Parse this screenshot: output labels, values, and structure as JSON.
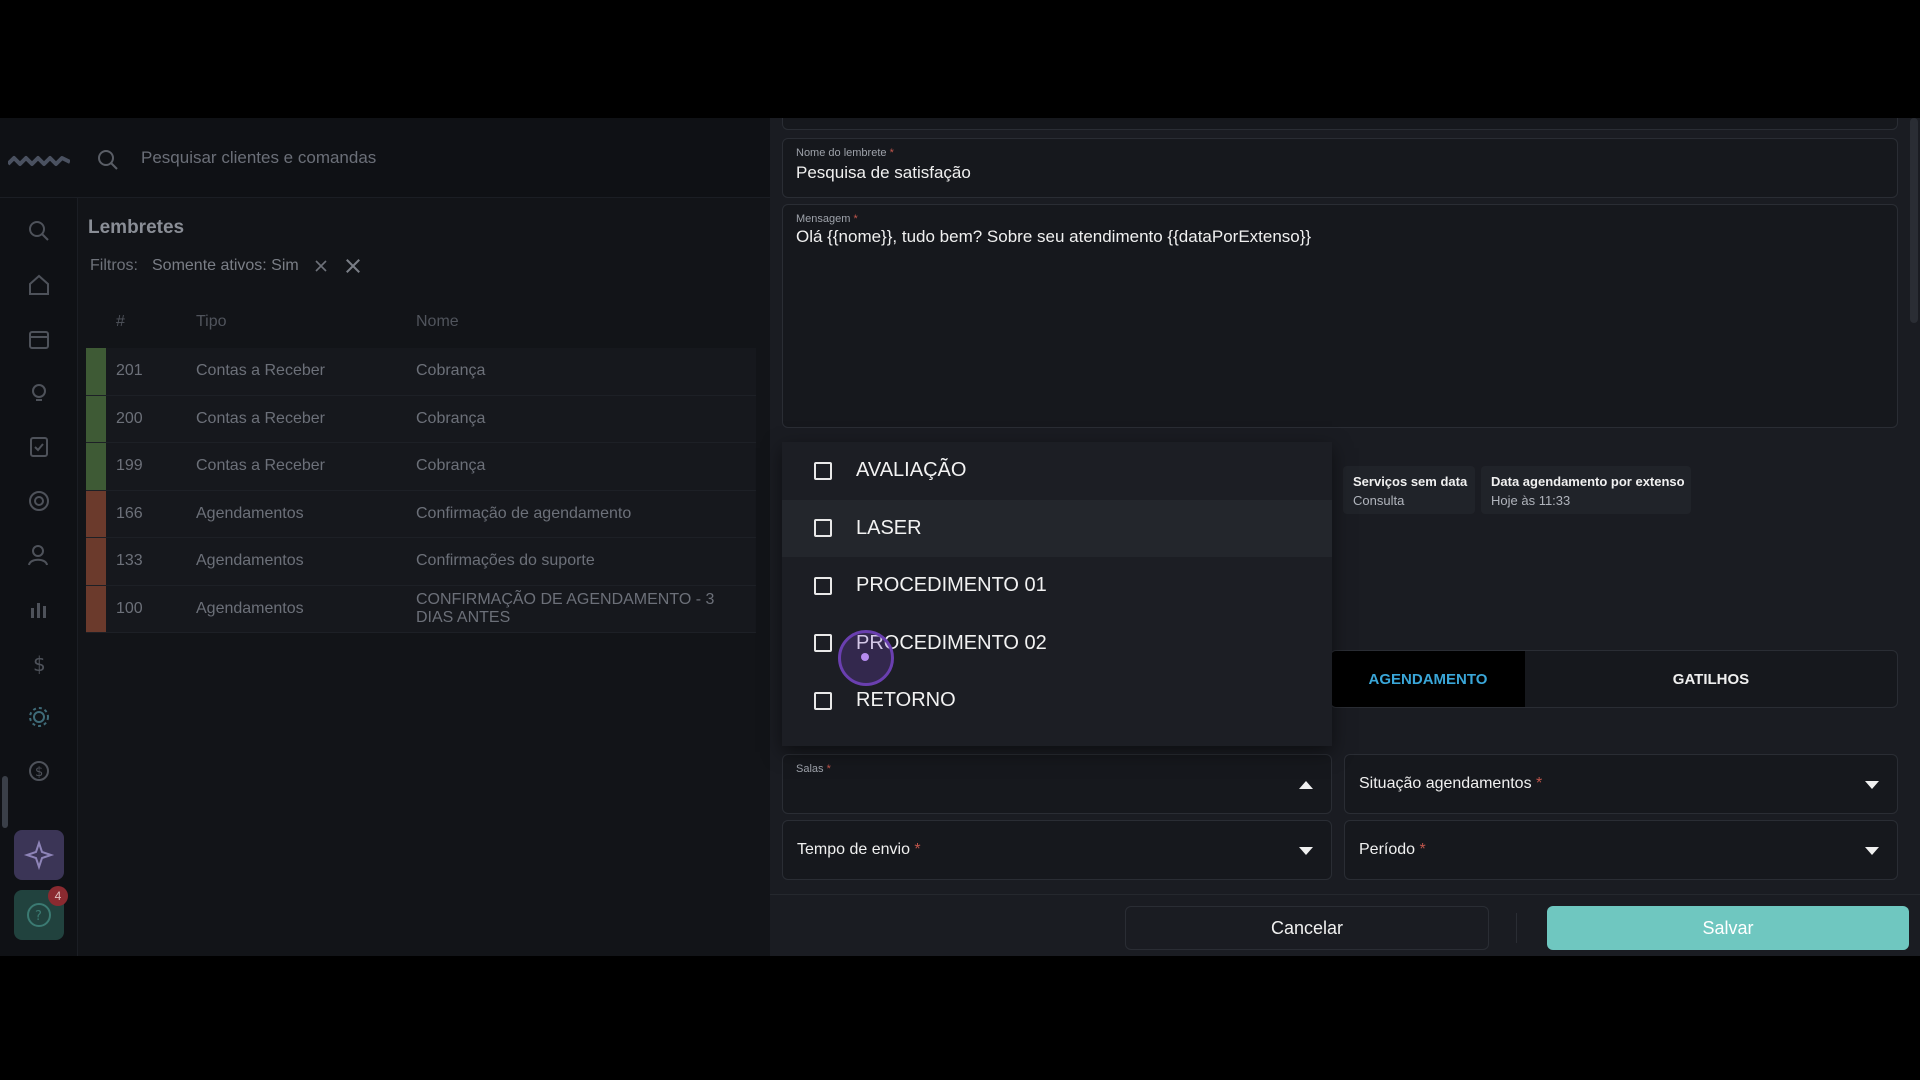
{
  "search": {
    "placeholder": "Pesquisar clientes e comandas"
  },
  "list": {
    "title": "Lembretes",
    "filters_label": "Filtros:",
    "filter_chip": "Somente ativos: Sim",
    "columns": [
      "#",
      "Tipo",
      "Nome"
    ],
    "rows": [
      {
        "id": "201",
        "tipo": "Contas a Receber",
        "nome": "Cobrança",
        "color": "#3e5a35"
      },
      {
        "id": "200",
        "tipo": "Contas a Receber",
        "nome": "Cobrança",
        "color": "#3e5a35"
      },
      {
        "id": "199",
        "tipo": "Contas a Receber",
        "nome": "Cobrança",
        "color": "#3e5a35"
      },
      {
        "id": "166",
        "tipo": "Agendamentos",
        "nome": "Confirmação de agendamento",
        "color": "#6b3a2c"
      },
      {
        "id": "133",
        "tipo": "Agendamentos",
        "nome": "Confirmações do suporte",
        "color": "#6b3a2c"
      },
      {
        "id": "100",
        "tipo": "Agendamentos",
        "nome": "CONFIRMAÇÃO DE AGENDAMENTO - 3 DIAS ANTES",
        "color": "#6b3a2c"
      }
    ]
  },
  "sidebar": {
    "icons": [
      "search-icon",
      "home-icon",
      "calendar-icon",
      "lightbulb-icon",
      "checklist-icon",
      "target-icon",
      "user-icon",
      "bar-chart-icon",
      "dollar-icon",
      "gear-icon",
      "coin-icon"
    ],
    "ai_icon": "sparkle-icon",
    "chat_icon": "chat-icon",
    "badge_count": "4"
  },
  "form": {
    "name_label": "Nome do lembrete",
    "name_value": "Pesquisa de satisfação",
    "message_label": "Mensagem",
    "message_value": "Olá {{nome}}, tudo bem? Sobre seu atendimento {{dataPorExtenso}}",
    "required_mark": "*",
    "variables": [
      {
        "title": "Serviços sem data",
        "value": "Consulta"
      },
      {
        "title": "Data agendamento por extenso",
        "value": "Hoje às 11:33"
      }
    ],
    "tabs": [
      {
        "label": "AGENDAMENTO"
      },
      {
        "label": "GATILHOS"
      }
    ],
    "salas_label": "Salas",
    "situacao_label": "Situação agendamentos",
    "tempo_label": "Tempo de envio",
    "periodo_label": "Período",
    "cancel_label": "Cancelar",
    "save_label": "Salvar"
  },
  "dropdown": {
    "options": [
      "AVALIAÇÃO",
      "LASER",
      "PROCEDIMENTO 01",
      "PROCEDIMENTO 02",
      "RETORNO"
    ]
  },
  "colors": {
    "accent": "#6fc7c0",
    "tab_active_text": "#3aa6d8",
    "required": "#c0564c"
  }
}
